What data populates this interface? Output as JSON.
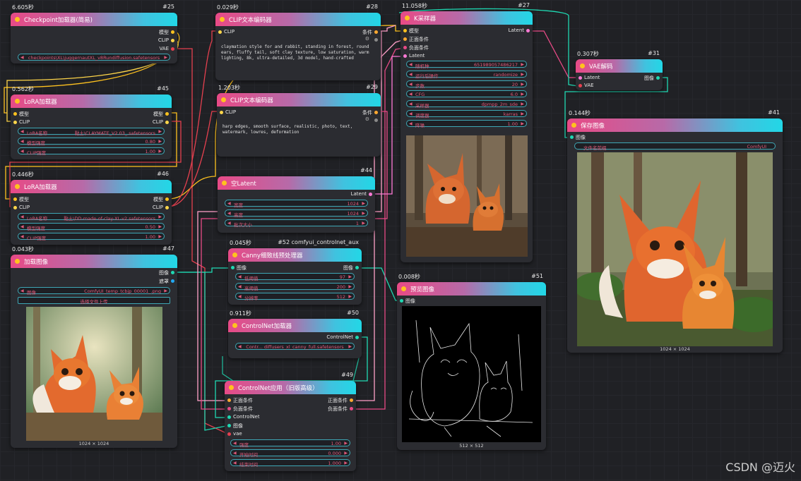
{
  "colors": {
    "model_socket": "#ffc21f",
    "clip_socket": "#ffd64a",
    "vae_socket": "#e5404f",
    "cond_socket": "#ffa931",
    "image_socket": "#64b5f6",
    "latent_socket": "#ff9cf9"
  },
  "nodes": {
    "ckpt": {
      "time": "6.605秒",
      "id": "#25",
      "title": "Checkpoint加载器(简易)",
      "outputs": [
        "模型",
        "CLIP",
        "VAE"
      ],
      "ckpt_name": "checkpoints\\XL\\juggernautXL_v8Rundiffusion.safetensors"
    },
    "lora1": {
      "time": "0.562秒",
      "id": "#45",
      "title": "LoRA加载器",
      "inputs": [
        "模型",
        "CLIP"
      ],
      "outputs": [
        "模型",
        "CLIP"
      ],
      "widgets": [
        {
          "label": "LoRA名称",
          "value": "黏土\\CLAYMATE_V2.03_.safetensors"
        },
        {
          "label": "模型强度",
          "value": "0.80"
        },
        {
          "label": "CLIP强度",
          "value": "1.00"
        }
      ]
    },
    "lora2": {
      "time": "0.446秒",
      "id": "#46",
      "title": "LoRA加载器",
      "inputs": [
        "模型",
        "CLIP"
      ],
      "outputs": [
        "模型",
        "CLIP"
      ],
      "widgets": [
        {
          "label": "LoRA名称",
          "value": "黏土\\DD-made-of-clay-XL-v2.safetensors"
        },
        {
          "label": "模型强度",
          "value": "0.50"
        },
        {
          "label": "CLIP强度",
          "value": "1.00"
        }
      ]
    },
    "loadimg": {
      "time": "0.043秒",
      "id": "#47",
      "title": "加载图像",
      "outputs": [
        "图像",
        "遮罩"
      ],
      "image_label": "图像",
      "image_value": "ComfyUI_temp_tcbjp_00001_.png",
      "upload_label": "选择文件上传",
      "caption": "1024 × 1024"
    },
    "clip1": {
      "time": "0.029秒",
      "id": "#28",
      "title": "CLIP文本编码器",
      "input": "CLIP",
      "output": "条件",
      "text": "claymation style for and rabbit, standing in forest, round ears, fluffy tail, soft clay texture, low saturation, warm lighting, 8k, ultra-detailed, 3d model, hand-crafted"
    },
    "clip2": {
      "time": "1.203秒",
      "id": "#29",
      "title": "CLIP文本编码器",
      "input": "CLIP",
      "output": "条件",
      "text": "harp edges, smooth surface, realistic, photo, text, watermark, lowres, deformation"
    },
    "latent": {
      "id": "#44",
      "title": "空Latent",
      "output": "Latent",
      "widgets": [
        {
          "label": "宽度",
          "value": "1024"
        },
        {
          "label": "高度",
          "value": "1024"
        },
        {
          "label": "批次大小",
          "value": "1"
        }
      ]
    },
    "canny": {
      "time": "0.045秒",
      "id": "#52 comfyui_controlnet_aux",
      "title": "Canny细致线预处理器",
      "input": "图像",
      "output": "图像",
      "widgets": [
        {
          "label": "低阈值",
          "value": "97"
        },
        {
          "label": "高阈值",
          "value": "200"
        },
        {
          "label": "分辨率",
          "value": "512"
        }
      ]
    },
    "cnload": {
      "time": "0.911秒",
      "id": "#50",
      "title": "ControlNet加载器",
      "output": "ControlNet",
      "model": "Contr... diffusers_xl_canny_full.safetensors"
    },
    "cnapply": {
      "id": "#49",
      "title": "ControlNet应用（旧版高级）",
      "inputs": [
        "正面条件",
        "负面条件",
        "ControlNet",
        "图像",
        "vae"
      ],
      "outputs": [
        "正面条件",
        "负面条件"
      ],
      "widgets": [
        {
          "label": "强度",
          "value": "1.00"
        },
        {
          "label": "开始时间",
          "value": "0.000"
        },
        {
          "label": "结束时间",
          "value": "1.000"
        }
      ]
    },
    "ksampler": {
      "time": "11.058秒",
      "id": "#27",
      "title": "K采样器",
      "inputs": [
        "模型",
        "正面条件",
        "负面条件",
        "Latent"
      ],
      "output": "Latent",
      "widgets": [
        {
          "label": "随机种",
          "value": "651989057486217"
        },
        {
          "label": "运行后操作",
          "value": "randomize"
        },
        {
          "label": "步数",
          "value": "20"
        },
        {
          "label": "CFG",
          "value": "6.0"
        },
        {
          "label": "采样器",
          "value": "dpmpp_2m_sde"
        },
        {
          "label": "调度器",
          "value": "karras"
        },
        {
          "label": "降噪",
          "value": "1.00"
        }
      ]
    },
    "preview": {
      "time": "0.008秒",
      "id": "#51",
      "title": "预览图像",
      "input": "图像",
      "caption": "512 × 512"
    },
    "vaedec": {
      "time": "0.307秒",
      "id": "#31",
      "title": "VAE解码",
      "inputs": [
        "Latent",
        "VAE"
      ],
      "output": "图像"
    },
    "save": {
      "time": "0.144秒",
      "id": "#41",
      "title": "保存图像",
      "input": "图像",
      "prefix_label": "文件名前缀",
      "prefix_value": "ComfyUI",
      "caption": "1024 × 1024"
    }
  },
  "watermark": "CSDN @迈火"
}
